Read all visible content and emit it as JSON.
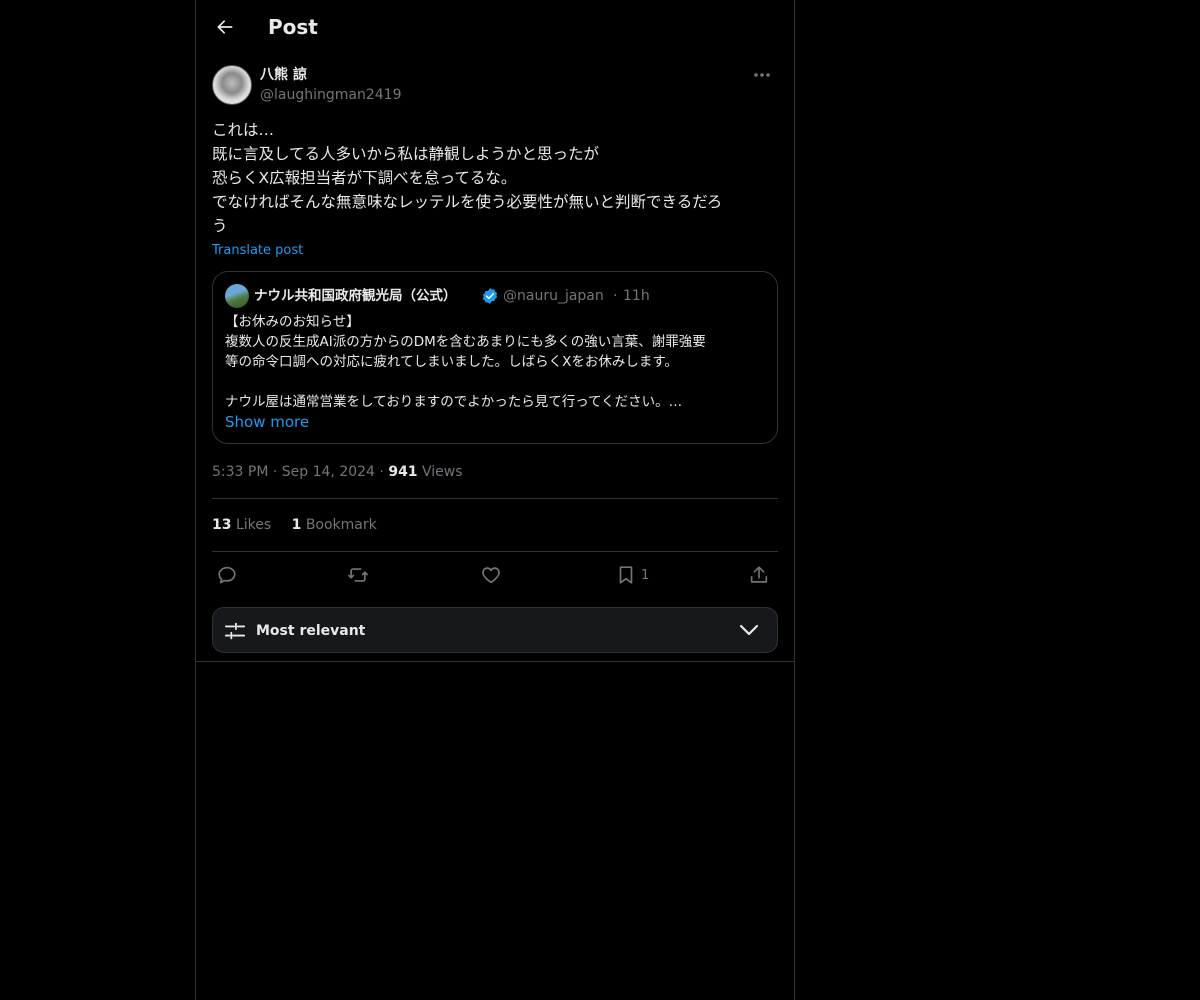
{
  "header": {
    "title": "Post"
  },
  "author": {
    "display_name": "八熊 諒",
    "handle": "@laughingman2419"
  },
  "post": {
    "lines": [
      "これは…",
      "既に言及してる人多いから私は静観しようかと思ったが",
      "恐らくX広報担当者が下調べを怠ってるな。",
      "でなければそんな無意味なレッテルを使う必要性が無いと判断できるだろ",
      "う"
    ],
    "translate_label": "Translate post"
  },
  "quote": {
    "name": "ナウル共和国政府観光局（公式）",
    "handle": "@nauru_japan",
    "separator": "·",
    "time": "11h",
    "lines": [
      "【お休みのお知らせ】",
      "複数人の反生成AI派の方からのDMを含むあまりにも多くの強い言葉、謝罪強要",
      "等の命令口調への対応に疲れてしまいました。しばらくXをお休みします。",
      "",
      "ナウル屋は通常営業をしておりますのでよかったら見て行ってください。…"
    ],
    "show_more": "Show more"
  },
  "meta": {
    "time": "5:33 PM",
    "sep1": "·",
    "date": "Sep 14, 2024",
    "sep2": "·",
    "views_count": "941",
    "views_label": "Views"
  },
  "stats": {
    "likes_count": "13",
    "likes_label": "Likes",
    "bookmarks_count": "1",
    "bookmarks_label": "Bookmark"
  },
  "actions": {
    "bookmark_count": "1"
  },
  "sort": {
    "label": "Most relevant"
  },
  "colors": {
    "accent": "#1d9bf0",
    "muted": "#71767b",
    "text": "#e7e9ea",
    "border": "#2f3336"
  }
}
